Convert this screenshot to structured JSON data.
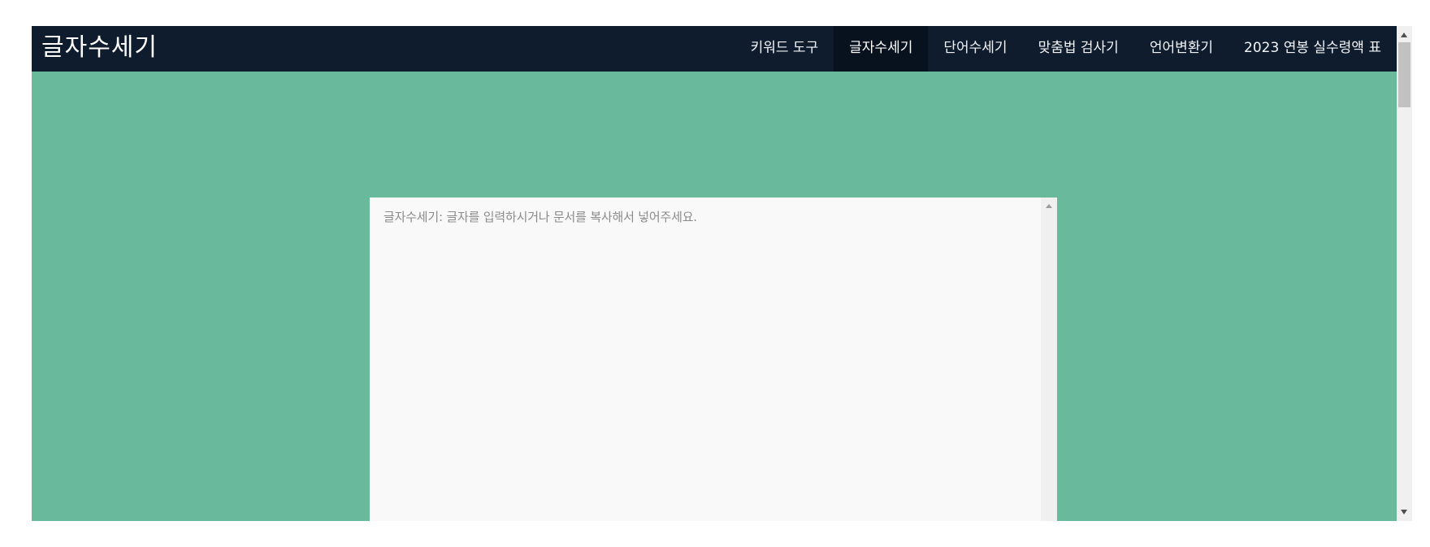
{
  "header": {
    "brand": "글자수세기",
    "nav": [
      {
        "label": "키워드 도구",
        "active": false
      },
      {
        "label": "글자수세기",
        "active": true
      },
      {
        "label": "단어수세기",
        "active": false
      },
      {
        "label": "맞춤법 검사기",
        "active": false
      },
      {
        "label": "언어변환기",
        "active": false
      },
      {
        "label": "2023 연봉 실수령액 표",
        "active": false
      }
    ]
  },
  "editor": {
    "placeholder": "글자수세기: 글자를 입력하시거나 문서를 복사해서 넣어주세요.",
    "value": ""
  },
  "colors": {
    "navbar_bg": "#0f1c2e",
    "navbar_active_bg": "#08111e",
    "page_bg": "#69b99d",
    "editor_bg": "#f9f9f9"
  }
}
